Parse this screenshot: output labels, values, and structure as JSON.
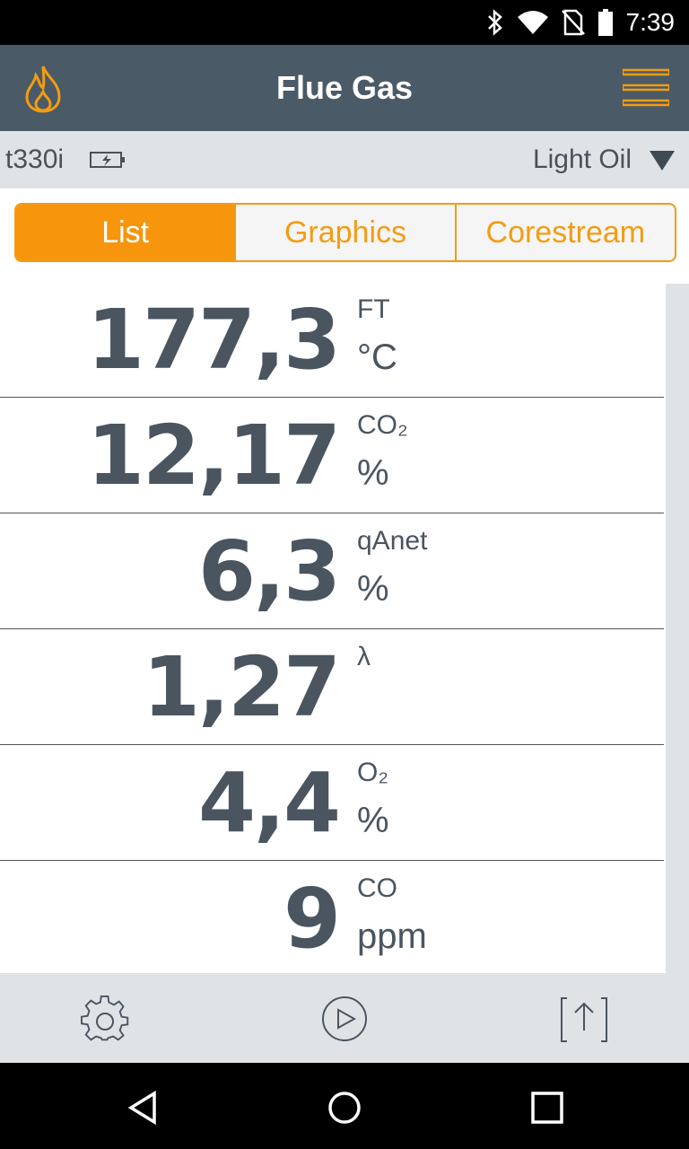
{
  "status": {
    "time": "7:39"
  },
  "app": {
    "title": "Flue Gas"
  },
  "device": {
    "name": "t330i",
    "fuel": "Light Oil"
  },
  "tabs": [
    {
      "label": "List",
      "active": true
    },
    {
      "label": "Graphics",
      "active": false
    },
    {
      "label": "Corestream",
      "active": false
    }
  ],
  "rows": [
    {
      "value": "177,3",
      "label": "FT",
      "unit": "°C"
    },
    {
      "value": "12,17",
      "label": "CO₂",
      "unit": "%"
    },
    {
      "value": "6,3",
      "label": "qAnet",
      "unit": "%"
    },
    {
      "value": "1,27",
      "label": "λ",
      "unit": ""
    },
    {
      "value": "4,4",
      "label": "O₂",
      "unit": "%"
    },
    {
      "value": "9",
      "label": "CO",
      "unit": "ppm"
    }
  ],
  "icons": {
    "app": "flame-icon",
    "menu": "hamburger-menu-icon",
    "settings": "gear-icon",
    "play": "play-icon",
    "export": "export-icon"
  },
  "colors": {
    "accent": "#f7950d",
    "appbar": "#4a5a66",
    "value_text": "#4a5560"
  }
}
